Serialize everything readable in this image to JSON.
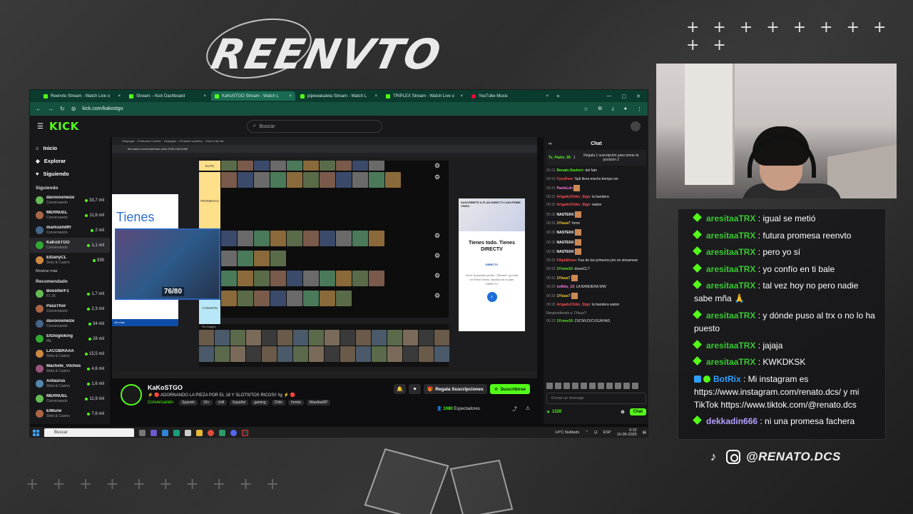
{
  "overlay": {
    "brand_text": "REENVTO",
    "plus_top": "+ + + + + + + + + +",
    "plus_bottom": "+ + + + + + + + + +",
    "social_handle": "@RENATO.DCS"
  },
  "browser": {
    "tabs": [
      {
        "label": "Reenvto Stream - Watch Live o",
        "icon": "kick-icon",
        "active": false
      },
      {
        "label": "Stream – Kick Dashboard",
        "icon": "kick-icon",
        "active": false
      },
      {
        "label": "KaKoSTGO Stream - Watch L",
        "icon": "kick-icon",
        "active": true
      },
      {
        "label": "pipewakatela Stream - Watch L",
        "icon": "kick-icon",
        "active": false
      },
      {
        "label": "TRIPLEX Stream - Watch Live o",
        "icon": "kick-icon",
        "active": false
      },
      {
        "label": "YouTube Music",
        "icon": "youtube-music-icon",
        "active": false
      }
    ],
    "url": "kick.com/kakostgo"
  },
  "kick": {
    "logo": "KICK",
    "search_placeholder": "Buscar",
    "nav": [
      "Inicio",
      "Explorar",
      "Siguiendo"
    ],
    "following_title": "Siguiendo",
    "following": [
      {
        "name": "davooxeneize",
        "category": "Conversando",
        "viewers": "33,7 mil"
      },
      {
        "name": "MERNUEL",
        "category": "Conversando",
        "viewers": "11,6 mil"
      },
      {
        "name": "markushdffr",
        "category": "Conversando",
        "viewers": "2 mil"
      },
      {
        "name": "KaKoSTGO",
        "category": "Conversando",
        "viewers": "1,1 mil"
      },
      {
        "name": "ElDanyCL",
        "category": "Slots & Casino",
        "viewers": "935"
      }
    ],
    "show_more": "Mostrar más",
    "recommended_title": "Recomendado",
    "recommended": [
      {
        "name": "BoostterF1",
        "category": "F1 25",
        "viewers": "1,7 mil"
      },
      {
        "name": "PassThor",
        "category": "Conversando",
        "viewers": "2,3 mil"
      },
      {
        "name": "davooxeneize",
        "category": "Conversando",
        "viewers": "34 mil"
      },
      {
        "name": "ElGlogloking",
        "category": "IRL",
        "viewers": "28 mil"
      },
      {
        "name": "LACOBRAAA",
        "category": "Slots & Casino",
        "viewers": "15,5 mil"
      },
      {
        "name": "Machete_Vilches",
        "category": "Slots & Casino",
        "viewers": "4,6 mil"
      },
      {
        "name": "Antaurus",
        "category": "Slots & Casino",
        "viewers": "1,6 mil"
      },
      {
        "name": "MERNUEL",
        "category": "Conversando",
        "viewers": "11,9 mil"
      },
      {
        "name": "ElMune",
        "category": "Slots & Casino",
        "viewers": "7,6 mil"
      }
    ]
  },
  "player": {
    "ad_left_text": "Tienes",
    "ad_left_footer": "Ver más",
    "pip_subs": "76/80",
    "ad_right_title": "Tienes todo. Tienes DIRECTV",
    "ad_right_head": "SUSCRÍBETE A PLAN DIRECTV CON PRIME VIDEO",
    "ad_right_brand": "DIRECTV",
    "ad_right_fine": "No te la puedes perder. \"Menem\" ya está en Prime Video, incluido en tu plan DIRECTV",
    "pool_label": "Pic images",
    "tier_labels": [
      "ELITE",
      "PROMESAS",
      "",
      "",
      "",
      "COMODÍN"
    ]
  },
  "stream": {
    "streamer": "KaKoSTGO",
    "title": "⚡ 🔴 ADORNANDO LA PIEZA POR EL 18 Y SLOTSITOS RICOS!! !ig ⚡ 🔴",
    "category": "Conversando",
    "tags": [
      "Spanish",
      "18+",
      "chill",
      "Español",
      "gaming",
      "Chile",
      "fomita",
      "WawitasRP"
    ],
    "gift_label": "Regala Suscripciones",
    "subscribe_label": "Suscribirse",
    "viewers": "1080",
    "viewers_label": "Espectadores"
  },
  "kick_chat": {
    "title": "Chat",
    "pinned_user": "Tu_Padre_69",
    "pinned_count": "1",
    "pinned_text": "Regala 1 suscripción para tomar la posición 2",
    "messages": [
      {
        "time": "00:31",
        "user": "Renato.Xavierrr",
        "text": ": del fato",
        "color": "#53fc18"
      },
      {
        "time": "00:31",
        "user": "FyesDeer",
        "text": ": Spk lleva mucho tiempo wn",
        "color": "#ff4d4d"
      },
      {
        "time": "00:31",
        "user": "PaoloLdc",
        "text": ":",
        "color": "#ff7ad9"
      },
      {
        "time": "00:31",
        "user": "ArigadoChiko_Stgo",
        "text": ": la bandera",
        "color": "#ff4d4d"
      },
      {
        "time": "00:32",
        "user": "ArigadoChiko_Stgo",
        "text": ": waton",
        "color": "#ff4d4d"
      },
      {
        "time": "00:32",
        "user": "NASTEKK",
        "text": ":",
        "color": "#ffffff"
      },
      {
        "time": "00:32",
        "user": "1Yisus7",
        "text": ": fome",
        "color": "#ffd23f"
      },
      {
        "time": "00:32",
        "user": "NASTEKK",
        "text": ":",
        "color": "#ffffff"
      },
      {
        "time": "00:32",
        "user": "NASTEKK",
        "text": ":",
        "color": "#ffffff"
      },
      {
        "time": "00:32",
        "user": "NASTEKK",
        "text": ":",
        "color": "#ffffff"
      },
      {
        "time": "00:32",
        "user": "FilipoEtnos",
        "text": ": Fue de los primeros pro en streamear",
        "color": "#ff4d4d"
      },
      {
        "time": "00:32",
        "user": "1Yrxnv10",
        "text": ": downCL?",
        "color": "#53fc18"
      },
      {
        "time": "00:32",
        "user": "1Yisus7",
        "text": ":",
        "color": "#ffd23f"
      },
      {
        "time": "00:32",
        "user": "nofkks_10",
        "text": ": LA BANDERA WW",
        "color": "#ff7ad9"
      },
      {
        "time": "00:32",
        "user": "1Yisus7",
        "text": ":",
        "color": "#ffd23f"
      },
      {
        "time": "00:32",
        "user": "ArigadoChiko_Stgo",
        "text": ": la bandera waton",
        "color": "#ff4d4d"
      },
      {
        "time": "00:32",
        "user": "1Yrxnv10",
        "text": ": ZXCNVZXCVSJKHAS",
        "color": "#53fc18"
      }
    ],
    "reply_note": "Respondiendo a 1Yisus7:",
    "input_placeholder": "Enviar un mensaje",
    "points": "1320",
    "chat_button": "Chat"
  },
  "taskbar": {
    "search": "Buscar",
    "weather": "14°C Nublado",
    "lang": "ESP",
    "time": "0:32",
    "date": "10-09-2025"
  },
  "overlay_chat": [
    {
      "user": "aresitaaTRX",
      "text": " : igual se metió",
      "type": "green"
    },
    {
      "user": "aresitaaTRX",
      "text": " : futura promesa reenvto",
      "type": "green"
    },
    {
      "user": "aresitaaTRX",
      "text": " : pero yo sí",
      "type": "green"
    },
    {
      "user": "aresitaaTRX",
      "text": " : yo confío en ti bale",
      "type": "green"
    },
    {
      "user": "aresitaaTRX",
      "text": " : tal vez hoy no pero nadie sabe mña 🙏",
      "type": "green"
    },
    {
      "user": "aresitaaTRX",
      "text": " : y dónde puso al trx o no lo ha puesto",
      "type": "green"
    },
    {
      "user": "aresitaaTRX",
      "text": " : jajaja",
      "type": "green"
    },
    {
      "user": "aresitaaTRX",
      "text": " : KWKDKSK",
      "type": "green"
    },
    {
      "user": "BotRix",
      "text": " : Mi instagram es https://www.instagram.com/renato.dcs/ y mi TikTok https://www.tiktok.com/@renato.dcs",
      "type": "bot"
    },
    {
      "user": "dekkadin666",
      "text": " : ni una promesa fachera",
      "type": "purple"
    }
  ]
}
